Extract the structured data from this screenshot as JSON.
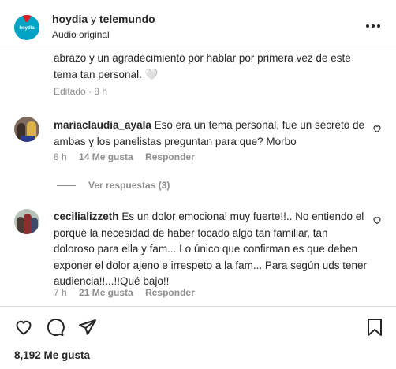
{
  "header": {
    "account_name": "hoydia",
    "joiner": "y",
    "collaborator": "telemundo",
    "subtitle": "Audio original",
    "logo_text": "hoydia"
  },
  "comments": [
    {
      "text": "abrazo y un agradecimiento por hablar por primera vez de este tema tan personal. 🤍",
      "edited": "Editado",
      "time": "8 h"
    },
    {
      "username": "mariaclaudia_ayala",
      "text": "Eso era un tema personal, fue un secreto de ambas y los panelistas preguntan para que? Morbo",
      "time": "8 h",
      "likes": "14 Me gusta",
      "reply": "Responder"
    },
    {
      "username": "cecilializzeth",
      "text": "Es un dolor emocional muy fuerte!!.. No entiendo el porqué la necesidad de haber tocado algo tan familiar, tan doloroso para ella y fam... Lo único que confirman es que deben exponer el dolor ajeno e irrespeto a la fam... Para según uds tener audiencia!!...!!Qué bajo!!",
      "time": "7 h",
      "likes": "21 Me gusta",
      "reply": "Responder"
    }
  ],
  "view_replies": "Ver respuestas (3)",
  "likes_count": "8,192 Me gusta",
  "colors": {
    "text": "#262626",
    "secondary": "#8e8e8e",
    "divider": "#dbdbdb",
    "brand_red": "#e11f26",
    "brand_blue": "#00a3c4"
  },
  "icons": [
    "more-icon",
    "heart-outline-icon",
    "comment-icon",
    "share-icon",
    "bookmark-icon"
  ]
}
